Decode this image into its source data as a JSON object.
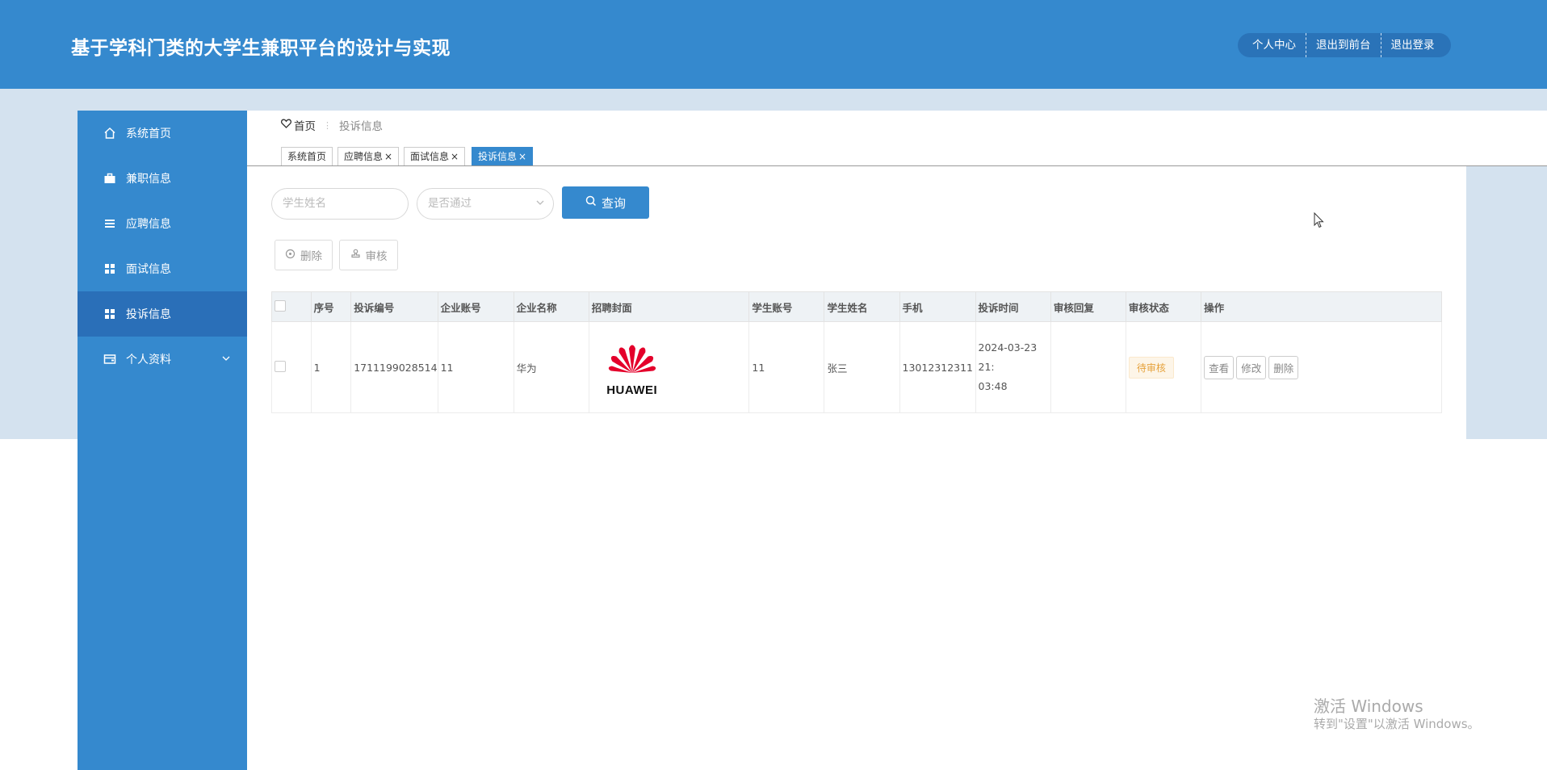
{
  "header": {
    "title": "基于学科门类的大学生兼职平台的设计与实现",
    "nav": [
      "个人中心",
      "退出到前台",
      "退出登录"
    ]
  },
  "sidebar": {
    "items": [
      {
        "label": "系统首页",
        "icon": "home-icon"
      },
      {
        "label": "兼职信息",
        "icon": "briefcase-icon"
      },
      {
        "label": "应聘信息",
        "icon": "list-icon"
      },
      {
        "label": "面试信息",
        "icon": "grid-icon"
      },
      {
        "label": "投诉信息",
        "icon": "grid-icon",
        "active": true
      },
      {
        "label": "个人资料",
        "icon": "wallet-icon",
        "expandable": true
      }
    ]
  },
  "breadcrumb": {
    "home": "首页",
    "current": "投诉信息"
  },
  "tabs": [
    {
      "label": "系统首页",
      "closable": false
    },
    {
      "label": "应聘信息",
      "closable": true
    },
    {
      "label": "面试信息",
      "closable": true
    },
    {
      "label": "投诉信息",
      "closable": true,
      "active": true
    }
  ],
  "search": {
    "name_placeholder": "学生姓名",
    "status_placeholder": "是否通过",
    "button_label": "查询"
  },
  "actions": {
    "delete_label": "删除",
    "review_label": "审核"
  },
  "table": {
    "columns": [
      "序号",
      "投诉编号",
      "企业账号",
      "企业名称",
      "招聘封面",
      "学生账号",
      "学生姓名",
      "手机",
      "投诉时间",
      "审核回复",
      "审核状态",
      "操作"
    ],
    "rows": [
      {
        "index": "1",
        "complaint_no": "1711199028514",
        "company_account": "11",
        "company_name": "华为",
        "cover_logo_text": "HUAWEI",
        "student_account": "11",
        "student_name": "张三",
        "phone": "13012312311",
        "time_line1": "2024-03-23 21:",
        "time_line2": "03:48",
        "reply": "",
        "status": "待审核",
        "ops": [
          "查看",
          "修改",
          "删除"
        ]
      }
    ]
  },
  "watermark": {
    "line1": "激活 Windows",
    "line2": "转到\"设置\"以激活 Windows。"
  },
  "colors": {
    "primary": "#3589ce",
    "primary_dark": "#2a6fb8",
    "band": "#d4e2ef",
    "pending": "#e6a23c",
    "huawei_red": "#e4002b"
  }
}
